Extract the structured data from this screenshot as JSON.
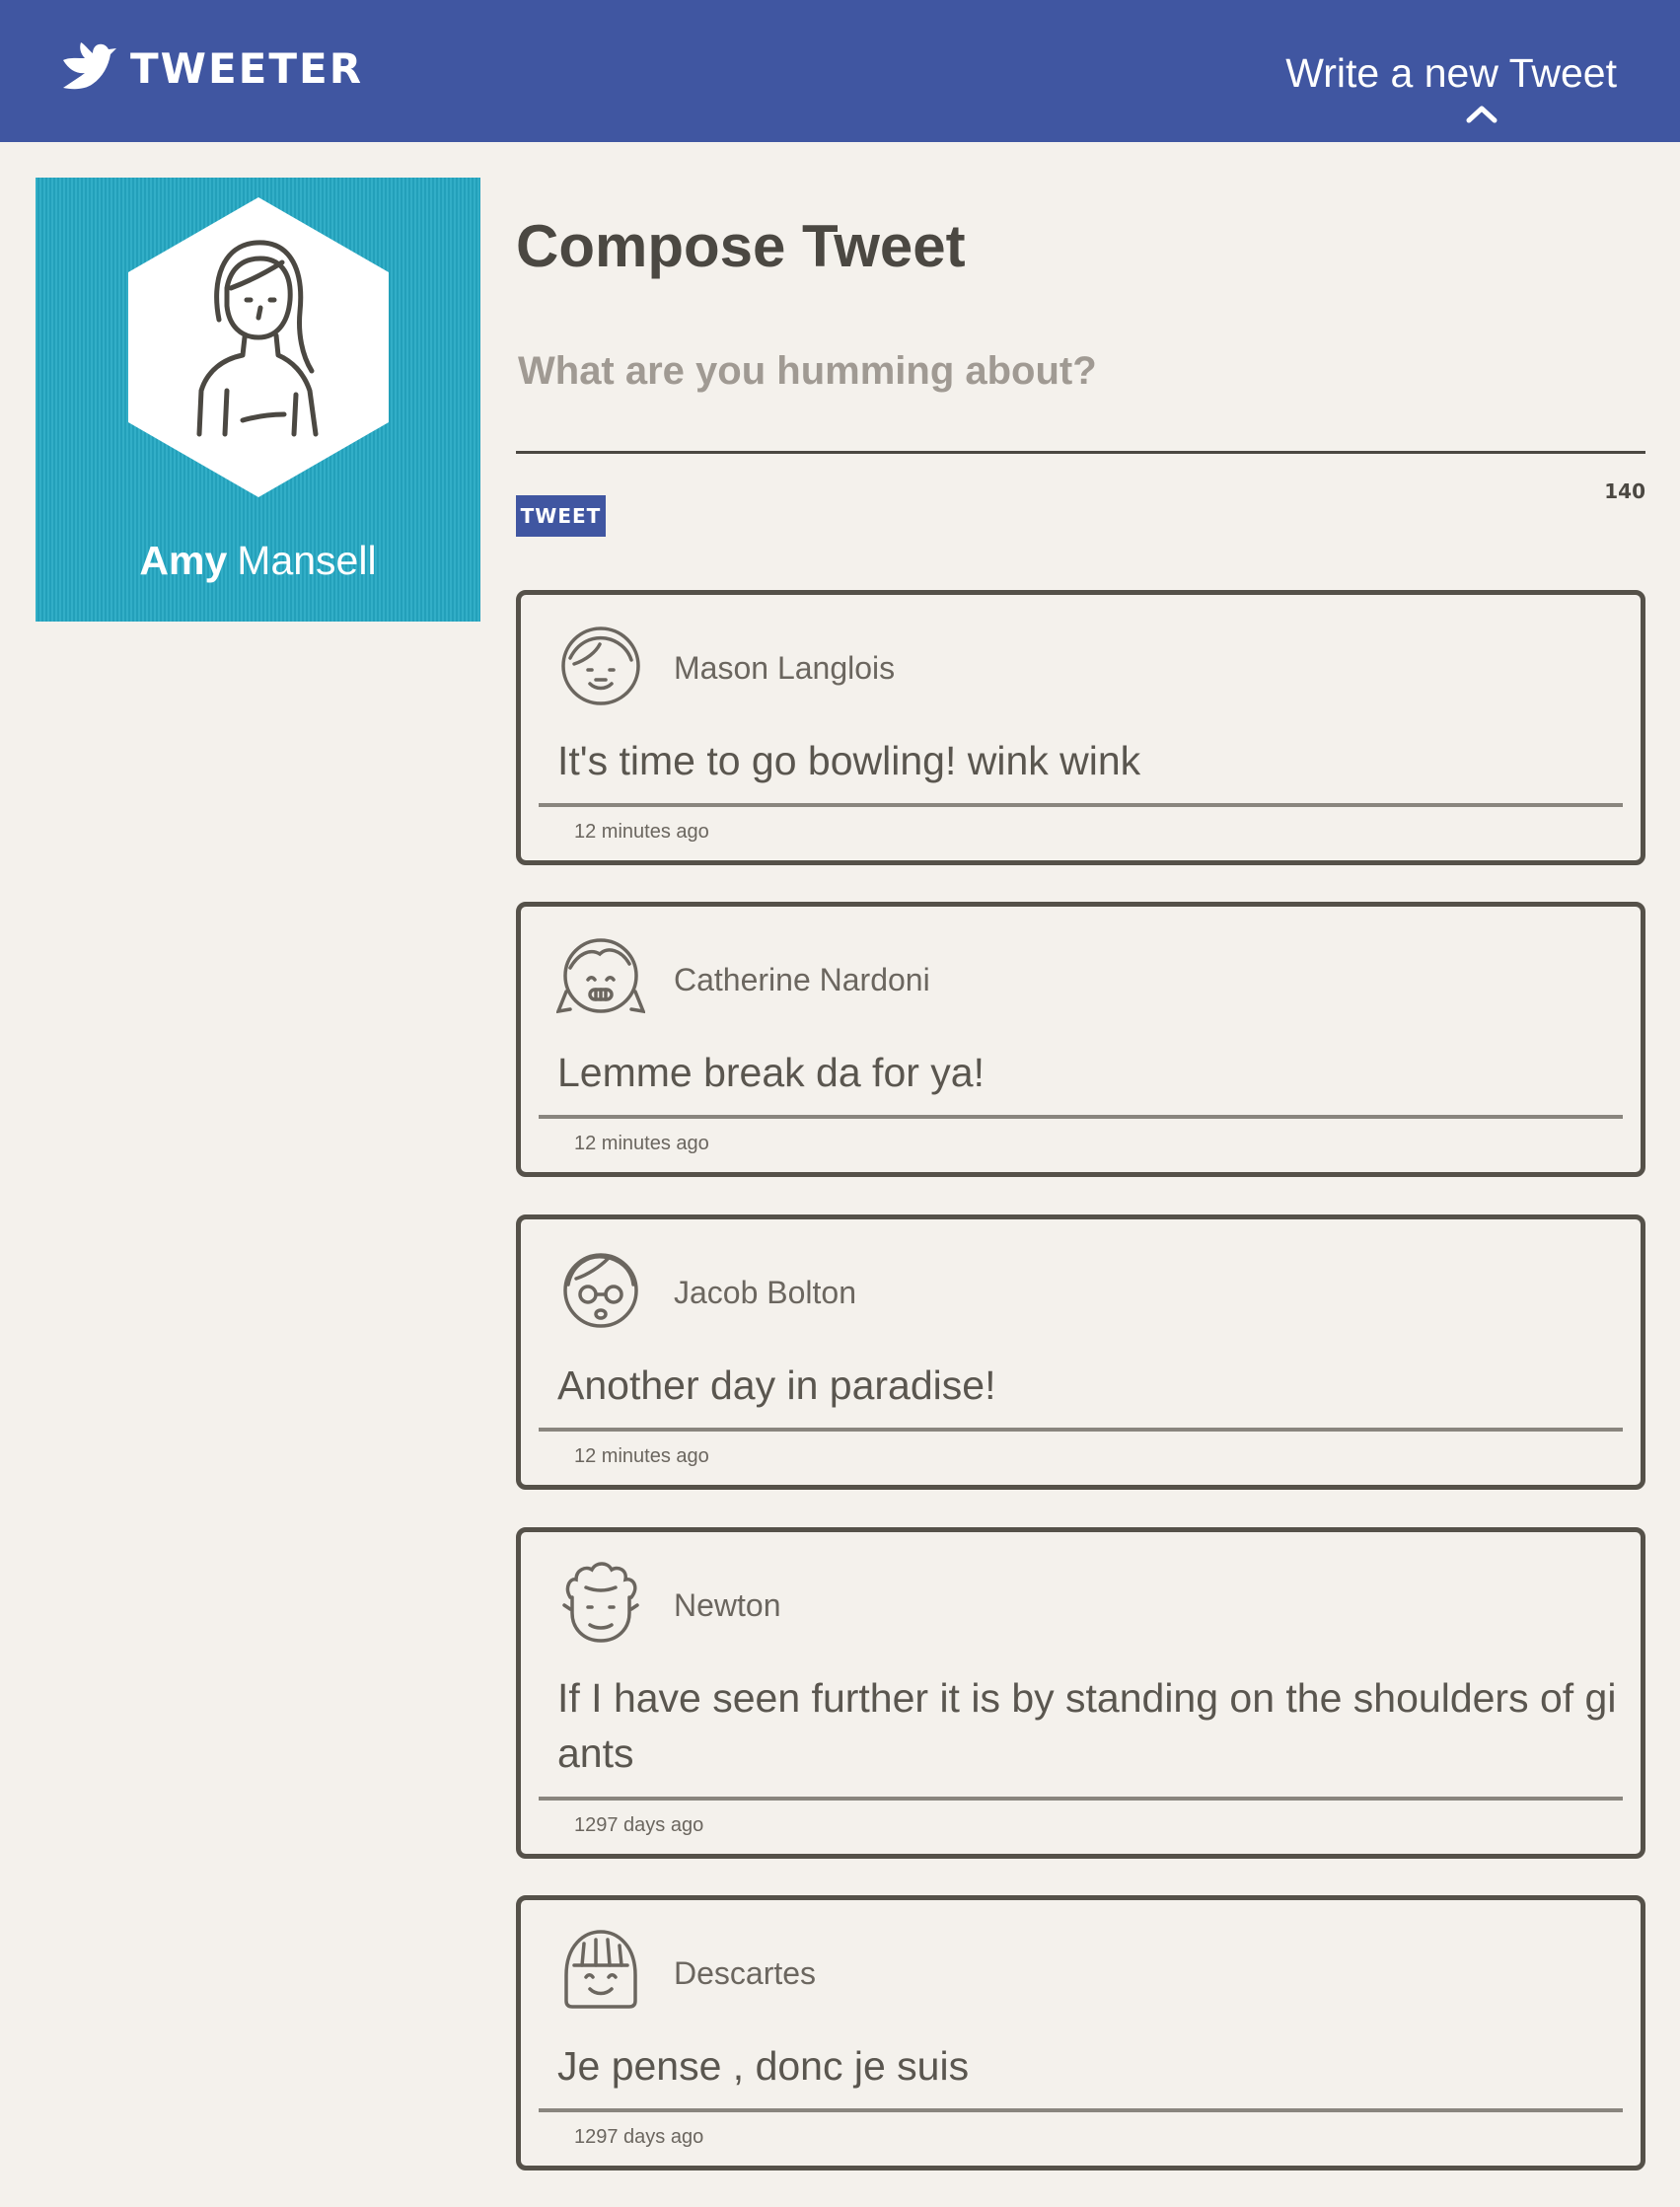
{
  "header": {
    "brand": "TWEETER",
    "brand_icon": "bird-icon",
    "compose_link": "Write a new Tweet",
    "compose_icon": "chevron-up-icon",
    "background_color": "#4056a1"
  },
  "profile": {
    "first_name": "Amy",
    "last_name": "Mansell",
    "avatar_icon": "woman-avatar-icon",
    "background_color": "#25a9c4"
  },
  "compose": {
    "title": "Compose Tweet",
    "placeholder": "What are you humming about?",
    "button_label": "TWEET",
    "counter": "140"
  },
  "tweets": [
    {
      "author": "Mason Langlois",
      "avatar_icon": "boy-avatar-icon",
      "content": "It's time to go bowling! wink wink",
      "time": "12 minutes ago"
    },
    {
      "author": "Catherine Nardoni",
      "avatar_icon": "girl-avatar-icon",
      "content": "Lemme break da for ya!",
      "time": "12 minutes ago"
    },
    {
      "author": "Jacob Bolton",
      "avatar_icon": "glasses-avatar-icon",
      "content": "Another day in paradise!",
      "time": "12 minutes ago"
    },
    {
      "author": "Newton",
      "avatar_icon": "curly-hair-avatar-icon",
      "content": "If I have seen further it is by standing on the shoulders of giants",
      "time": "1297 days ago"
    },
    {
      "author": "Descartes",
      "avatar_icon": "bangs-avatar-icon",
      "content": "Je pense , donc je suis",
      "time": "1297 days ago"
    }
  ]
}
